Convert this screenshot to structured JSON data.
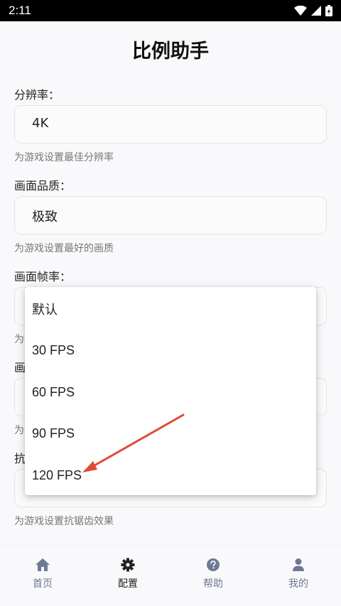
{
  "status_bar": {
    "time": "2:11",
    "icons": [
      "wifi-icon",
      "signal-icon",
      "battery-icon"
    ]
  },
  "app": {
    "title": "比例助手"
  },
  "fields": [
    {
      "label": "分辨率：",
      "value": "4K",
      "hint": "为游戏设置最佳分辨率"
    },
    {
      "label": "画面品质：",
      "value": "极致",
      "hint": "为游戏设置最好的画质"
    },
    {
      "label": "画面帧率：",
      "value": "",
      "hint": "为"
    },
    {
      "label": "画",
      "value": "",
      "hint": "为"
    },
    {
      "label": "抗",
      "value": "",
      "hint": "为游戏设置抗锯齿效果"
    }
  ],
  "dropdown": {
    "options": [
      "默认",
      "30 FPS",
      "60 FPS",
      "90 FPS",
      "120 FPS"
    ]
  },
  "annotation": {
    "color": "#e04b35"
  },
  "bottom_nav": {
    "tabs": [
      {
        "label": "首页",
        "icon": "home-icon"
      },
      {
        "label": "配置",
        "icon": "gear-icon"
      },
      {
        "label": "帮助",
        "icon": "help-icon"
      },
      {
        "label": "我的",
        "icon": "user-icon"
      }
    ],
    "active_index": 1,
    "colors": {
      "active": "#222222",
      "inactive": "#6c7a93"
    }
  }
}
